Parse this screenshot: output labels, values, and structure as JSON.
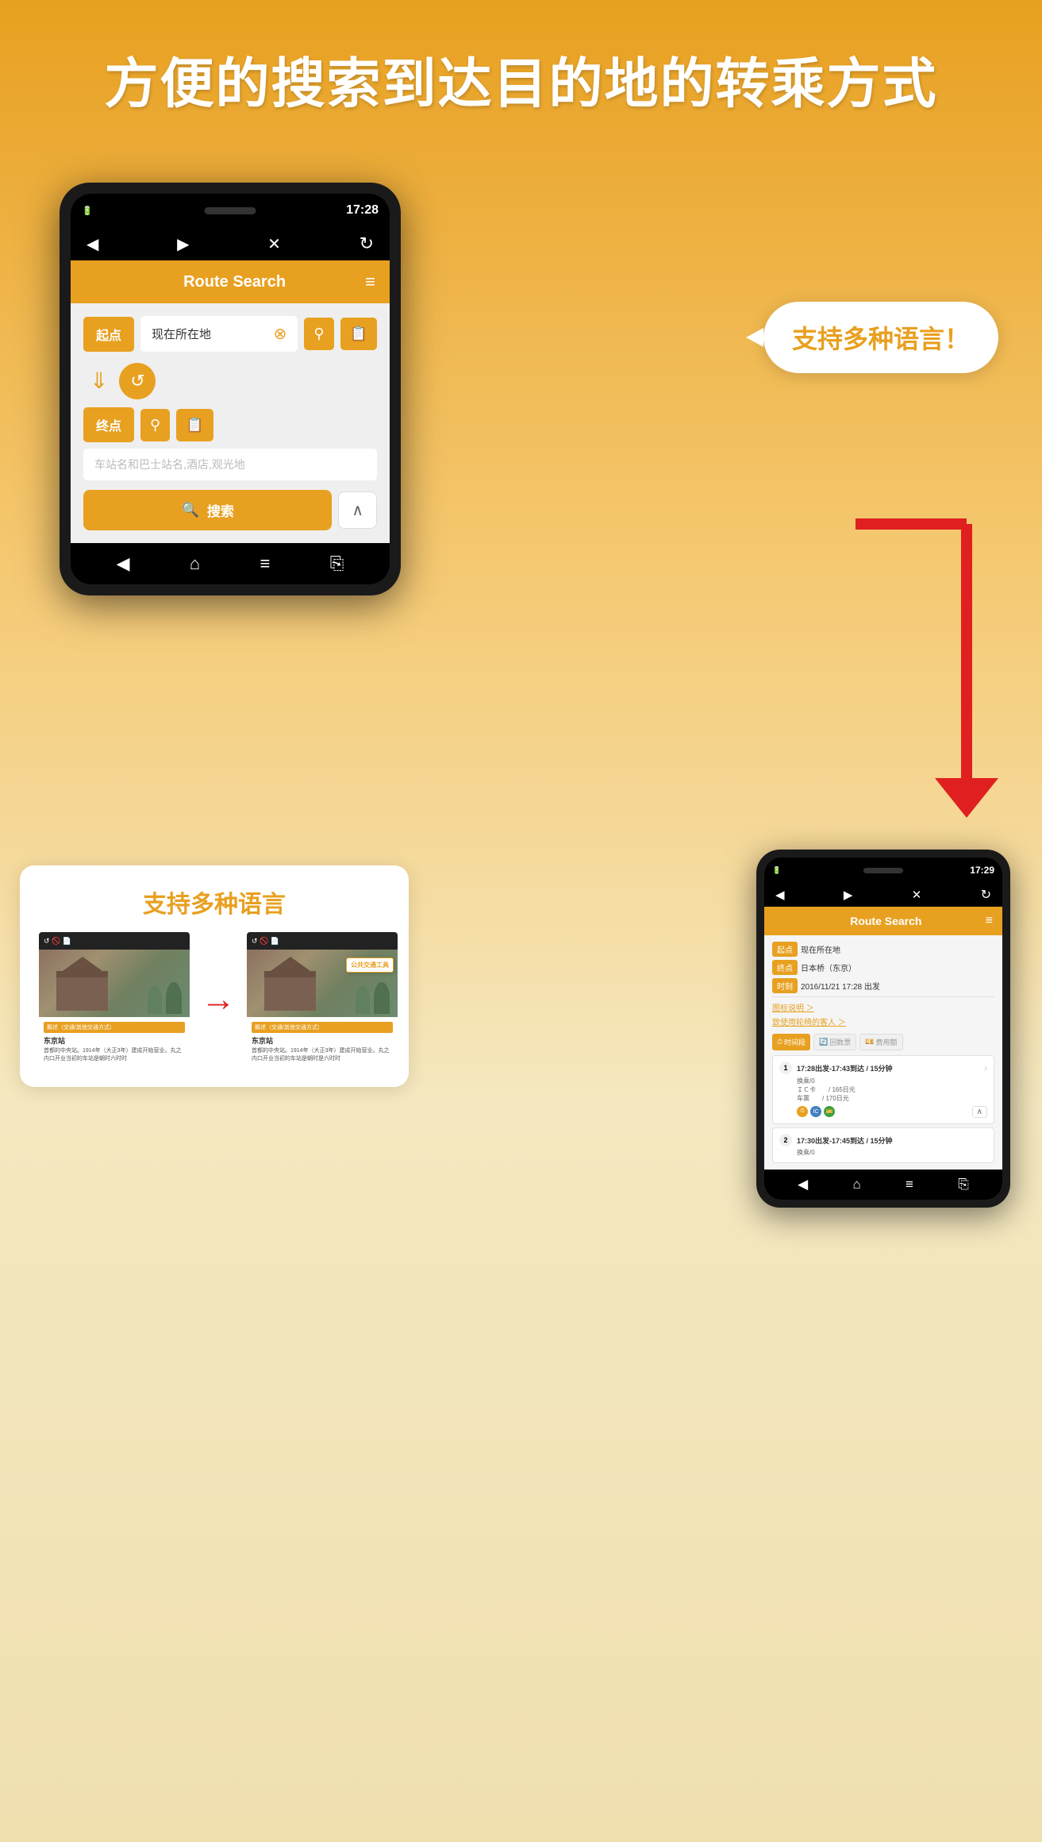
{
  "page": {
    "bg_gradient_start": "#E8A020",
    "bg_gradient_end": "#F0E0B0",
    "title": "方便的搜索到达目的地的转乘方式"
  },
  "large_phone": {
    "time": "17:28",
    "app_title": "Route Search",
    "menu_icon": "≡",
    "start_label": "起点",
    "start_value": "现在所在地",
    "end_label": "终点",
    "end_placeholder": "车站名和巴士站名,酒店,观光地",
    "search_label": "搜索",
    "nav_back": "◀",
    "nav_forward": "▶",
    "nav_close": "✕",
    "nav_refresh": "↻",
    "bottom_back": "◀",
    "bottom_home": "⌂",
    "bottom_menu": "≡",
    "bottom_share": "⎘"
  },
  "speech_bubble": {
    "text": "支持多种语言！"
  },
  "small_phone": {
    "time": "17:29",
    "app_title": "Route Search",
    "start_label": "起点",
    "start_value": "现在所在地",
    "end_label": "终点",
    "end_value": "日本桥（东京）",
    "time_label": "时刻",
    "time_value": "2016/11/21 17:28 出发",
    "icon_legend_link": "图标说明 ＞",
    "first_use_link": "致使用轮椅的客人 ＞",
    "tab1": "时间段",
    "tab2": "回数票",
    "tab3": "费用额",
    "result1_time": "17:28出发-17:43到达 / 15分钟",
    "result1_transfer": "换乘/0",
    "result1_ic": "ＩＣ卡　　/ 165日元",
    "result1_ticket": "车票　　/ 170日元",
    "result2_time": "17:30出发-17:45到达 / 15分钟",
    "result2_transfer": "换乘/0"
  },
  "bottom_card": {
    "title": "支持多种语言",
    "before_label": "概述（交通/其他交通方式）",
    "before_station": "东京站",
    "before_desc": "首都的中央站。1914年（大正3年）建成开始营业。丸之内口开业当初的车站是朝时六时时",
    "after_label": "概述（交通/其他交通方式）",
    "after_station": "东京站",
    "after_desc": "首都的中央站。1914年（大正3年）建成开始营业。丸之内口开业当初的车站是朝时是六时时",
    "popup_label": "公共交通工具"
  }
}
